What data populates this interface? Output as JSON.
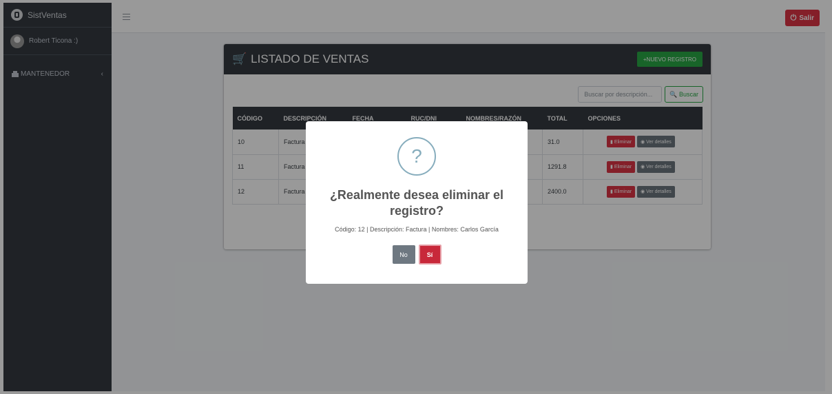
{
  "app": {
    "brand": "SistVentas"
  },
  "user": {
    "name": "Robert Ticona :)"
  },
  "sidebar": {
    "items": [
      {
        "label": "MANTENEDOR",
        "chevron": "‹"
      }
    ]
  },
  "topbar": {
    "logout_label": "Salir",
    "logout_icon": "⏻"
  },
  "card": {
    "title": "LISTADO DE VENTAS",
    "new_button_label": "+NUEVO REGISTRO",
    "search": {
      "placeholder": "Buscar por descripción...",
      "button_label": "Buscar",
      "button_icon": "🔍"
    }
  },
  "table": {
    "headers": [
      "CÓDIGO",
      "DESCRIPCIÓN",
      "FECHA",
      "RUC/DNI",
      "NOMBRES/RAZÓN",
      "TOTAL",
      "OPCIONES"
    ],
    "rows": [
      {
        "codigo": "10",
        "descripcion": "Factura",
        "total": "31.0"
      },
      {
        "codigo": "11",
        "descripcion": "Factura",
        "total": "1291.8"
      },
      {
        "codigo": "12",
        "descripcion": "Factura",
        "total": "2400.0"
      }
    ],
    "delete_label": "Eliminar",
    "details_label": "Ver detalles"
  },
  "modal": {
    "icon": "?",
    "title": "¿Realmente desea eliminar el registro?",
    "text": "Código: 12 | Descripción: Factura | Nombres: Carlos García",
    "no_label": "No",
    "yes_label": "Sí"
  },
  "colors": {
    "sidebar": "#343a40",
    "danger": "#dc3545",
    "success": "#28a745",
    "secondary": "#6c757d"
  }
}
